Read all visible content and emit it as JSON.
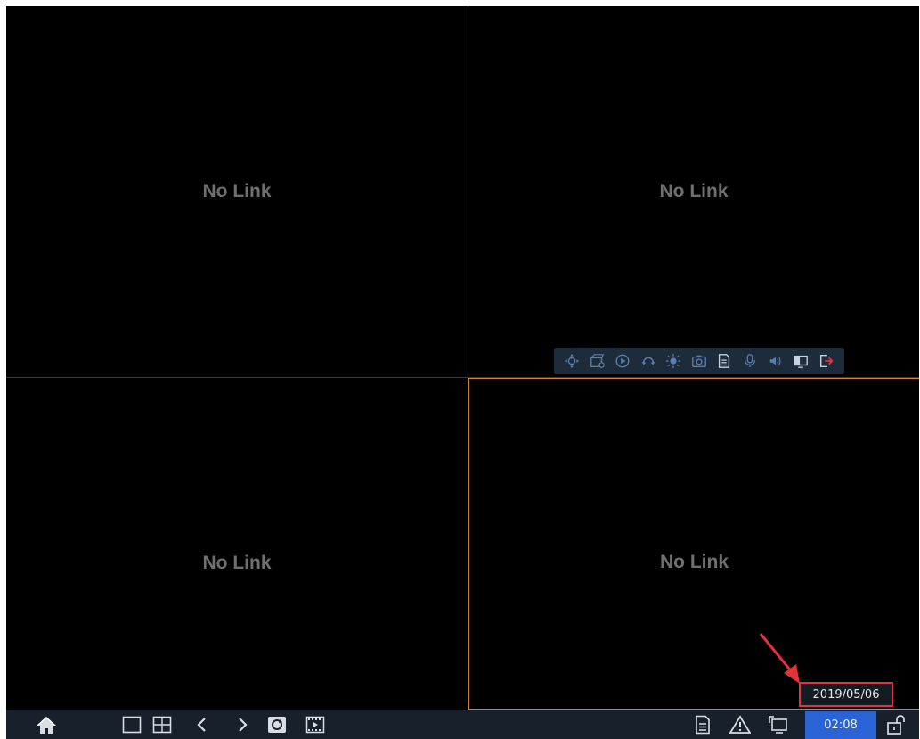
{
  "channels": [
    {
      "status": "No Link"
    },
    {
      "status": "No Link"
    },
    {
      "status": "No Link"
    },
    {
      "status": "No Link"
    }
  ],
  "channel_toolbar": {
    "icons": [
      "ptz-icon",
      "record-icon",
      "playback-icon",
      "rotate-icon",
      "brightness-icon",
      "snapshot-icon",
      "document-icon",
      "microphone-icon",
      "volume-icon",
      "display-icon",
      "exit-icon"
    ]
  },
  "tooltip": {
    "date": "2019/05/06"
  },
  "taskbar": {
    "time": "02:08",
    "left_icons": [
      "home-icon",
      "single-view-icon",
      "quad-view-icon",
      "prev-icon",
      "next-icon",
      "sequence-icon",
      "playback-film-icon"
    ],
    "right_icons": [
      "log-icon",
      "alarm-icon",
      "network-icon",
      "lock-icon"
    ]
  },
  "colors": {
    "selected_border": "#d9822b",
    "highlight_box": "#e0333a",
    "clock_bg": "#2a63d6",
    "taskbar_bg": "#17202b"
  }
}
